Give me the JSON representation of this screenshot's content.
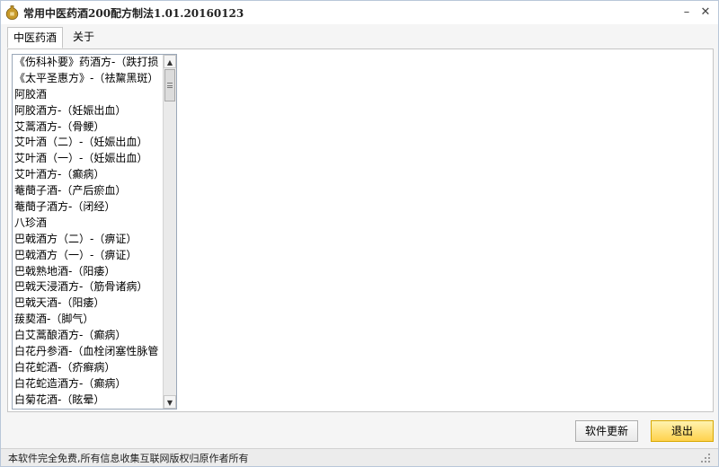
{
  "window": {
    "title": "常用中医药酒200配方制法1.01.20160123",
    "minimize_label": "–",
    "close_label": "✕"
  },
  "tabs": [
    {
      "label": "中医药酒",
      "active": true
    },
    {
      "label": "关于",
      "active": false
    }
  ],
  "recipe_list": {
    "items": [
      "《伤科补要》药酒方-（跌打损",
      "《太平圣惠方》-（祛黧黑斑）",
      "阿胶酒",
      "阿胶酒方-（妊娠出血）",
      "艾蒿酒方-（骨鲠）",
      "艾叶酒（二）-（妊娠出血）",
      "艾叶酒（一）-（妊娠出血）",
      "艾叶酒方-（癫病）",
      "菴蕳子酒-（产后瘀血）",
      "菴蕳子酒方-（闭经）",
      "八珍酒",
      "巴戟酒方（二）-（痹证）",
      "巴戟酒方（一）-（痹证）",
      "巴戟熟地酒-（阳痿）",
      "巴戟天浸酒方-（筋骨诸病）",
      "巴戟天酒-（阳痿）",
      "菝葜酒-（脚气）",
      "白艾蒿酿酒方-（癫病）",
      "白花丹参酒-（血栓闭塞性脉管",
      "白花蛇酒-（疥癣病）",
      "白花蛇造酒方-（癫病）",
      "白菊花酒-（眩晕）"
    ],
    "scroll_up": "▲",
    "scroll_down": "▼"
  },
  "buttons": {
    "update": "软件更新",
    "exit": "退出"
  },
  "status": {
    "text": "本软件完全免费,所有信息收集互联网版权归原作者所有"
  },
  "colors": {
    "exit_button": "#ffd24d",
    "window_border": "#b9c7d9",
    "app_icon": "#c89a2a"
  },
  "icons": {
    "app": "gourd-icon",
    "resize": "resize-grip-icon"
  }
}
